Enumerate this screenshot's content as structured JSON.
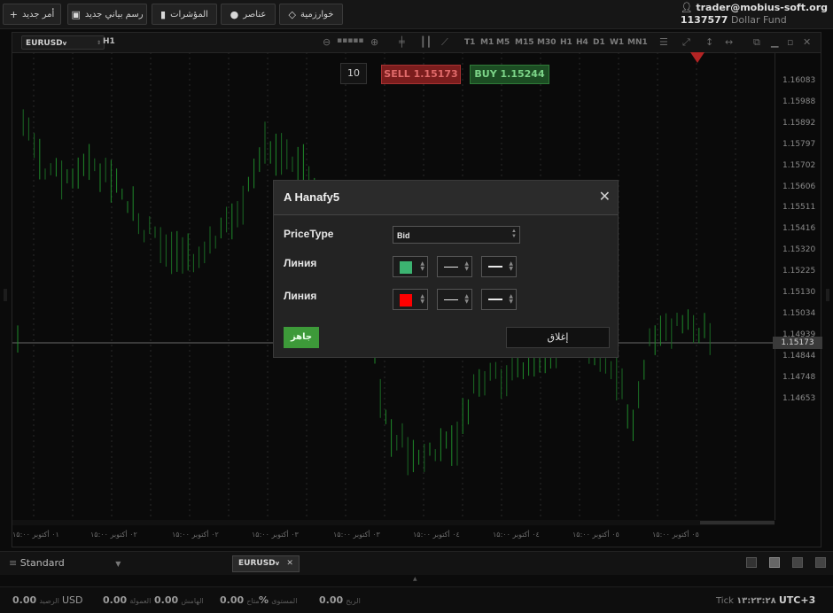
{
  "toolbar": {
    "new_order": "أمر جديد",
    "new_chart": "رسم بياني جديد",
    "indicators": "المؤشرات",
    "elements": "عناصر",
    "algorithms": "خوارزمية"
  },
  "account": {
    "email": "trader@mobius-soft.org",
    "number": "1137577",
    "name": "Dollar Fund"
  },
  "chart": {
    "symbol": "EURUSD",
    "timeframe": "H1",
    "timeframes": [
      "T1",
      "M1",
      "M5",
      "M15",
      "M30",
      "H1",
      "H4",
      "D1",
      "W1",
      "MN1"
    ],
    "prices": [
      "1.16083",
      "1.15988",
      "1.15892",
      "1.15797",
      "1.15702",
      "1.15606",
      "1.15511",
      "1.15416",
      "1.15320",
      "1.15225",
      "1.15130",
      "1.15034",
      "1.14939",
      "1.14844",
      "1.14748",
      "1.14653"
    ],
    "current_price": "1.15173",
    "times": [
      "۱۵:۰۰ ٠١ أكتوبر",
      "۱۵:۰۰ ٠٢ أكتوبر",
      "۱۵:۰۰ ٠٢ أكتوبر",
      "۱۵:۰۰ ٠٣ أكتوبر",
      "۱۵:۰۰ ٠٣ أكتوبر",
      "۱۵:۰۰ ٠٤ أكتوبر",
      "۱۵:۰۰ ٠٤ أكتوبر",
      "۱۵:۰۰ ٠٥ أكتوبر",
      "۱۵:۰۰ ٠٥ أكتوبر"
    ],
    "colors": {
      "up": "#1e8a2a",
      "down": "#1a6a24",
      "grid": "#2a2a2a"
    }
  },
  "trade": {
    "lots": "10",
    "sell_label": "SELL",
    "sell_price": "1.15173",
    "buy_label": "BUY",
    "buy_price": "1.15244"
  },
  "modal": {
    "title": "A Hanafy5",
    "close_icon": "close-icon",
    "price_type_label": "PriceType",
    "price_type_value": "Bid",
    "line1_label": "Линия",
    "line1_color": "#3cb371",
    "line2_label": "Линия",
    "line2_color": "#ff0000",
    "ok_label": "جاهز",
    "cancel_label": "إغلاق"
  },
  "bottom": {
    "layout": "Standard",
    "symbol_tab": "EURUSD"
  },
  "status": {
    "balance_value": "0.00",
    "balance_label": "الرصيد",
    "currency": "USD",
    "equity_value": "0.00",
    "equity_label": "العمولة",
    "margin_value": "0.00",
    "margin_label": "الهامش",
    "free_value": "0.00",
    "free_label": "متاح",
    "level_value": "%",
    "level_label": "المستوى",
    "profit_value": "0.00",
    "profit_label": "الربح",
    "tick_label": "Tick",
    "tick_value": "١٣:٢٣:٢٨",
    "timezone": "UTC+3"
  }
}
